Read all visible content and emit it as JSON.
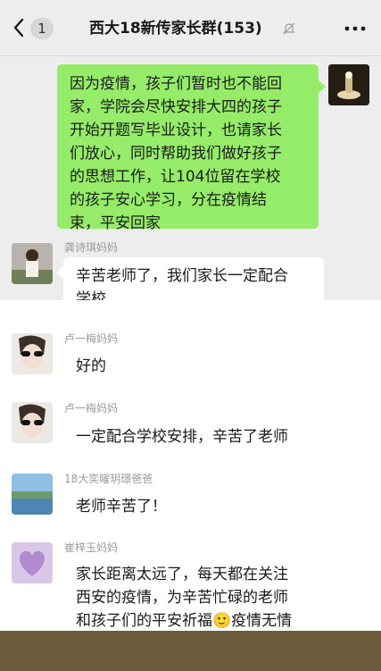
{
  "header": {
    "back_label": "1",
    "title": "西大18新传家长群(153)"
  },
  "messages": [
    {
      "sender": "self",
      "text": "因为疫情，孩子们暂时也不能回\n家，学院会尽快安排大四的孩子\n开始开题写毕业设计，也请家长\n们放心，同时帮助我们做好孩子\n的思想工作，让104位留在学校\n的孩子安心学习，分在疫情结\n束，平安回家"
    },
    {
      "name": "龚诗琪妈妈",
      "text": "辛苦老师了，我们家长一定配合\n学校"
    },
    {
      "name": "卢一梅妈妈",
      "text": "好的"
    },
    {
      "name": "卢一梅妈妈",
      "text": "一定配合学校安排，辛苦了老师"
    },
    {
      "name": "18大奕曜玥璟爸爸",
      "text": "老师辛苦了！"
    },
    {
      "name": "崔梓玉妈妈",
      "text": "家长距离太远了，每天都在关注\n西安的疫情，为辛苦忙碌的老师\n和孩子们的平安祈福🙂疫情无情\n人有情，盼望着春天的到来🙂"
    }
  ],
  "colors": {
    "background": "#ededed",
    "self_bubble": "#95ec69",
    "other_bubble": "#ffffff",
    "name_text": "#9a9a9a"
  }
}
